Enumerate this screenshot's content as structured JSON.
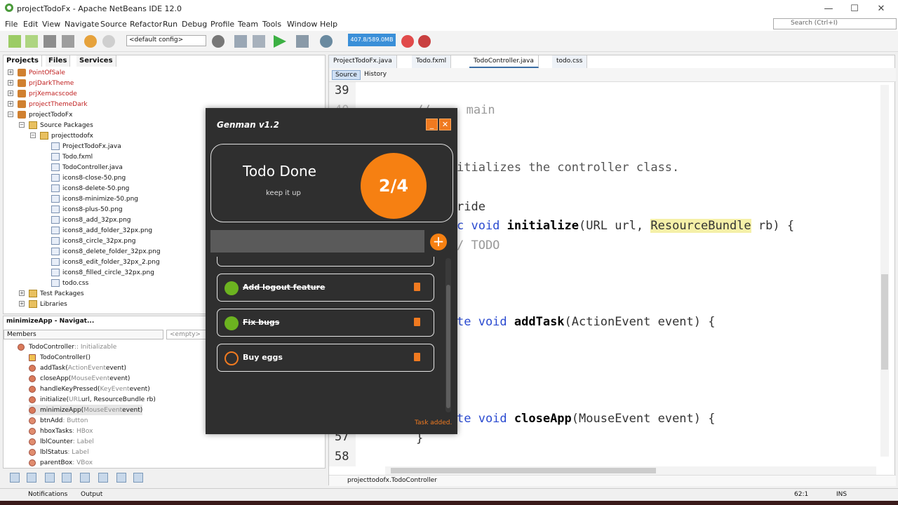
{
  "window": {
    "title": "projectTodoFx - Apache NetBeans IDE 12.0"
  },
  "menu": [
    "File",
    "Edit",
    "View",
    "Navigate",
    "Source",
    "Refactor",
    "Run",
    "Debug",
    "Profile",
    "Team",
    "Tools",
    "Window",
    "Help"
  ],
  "search": {
    "placeholder": "Search (Ctrl+I)"
  },
  "toolbar": {
    "config": "<default config>",
    "memory": "407.8/589.0MB"
  },
  "projects_panel": {
    "tabs": [
      "Projects",
      "Files",
      "Services"
    ],
    "tree": [
      {
        "label": "PointOfSale",
        "red": true
      },
      {
        "label": "prjDarkTheme",
        "red": true
      },
      {
        "label": "prjXemacscode",
        "red": true
      },
      {
        "label": "projectThemeDark",
        "red": true
      },
      {
        "label": "projectTodoFx",
        "red": false
      },
      {
        "label": "Source Packages",
        "red": false
      },
      {
        "label": "projecttodofx",
        "red": false
      },
      {
        "label": "ProjectTodoFx.java",
        "red": false
      },
      {
        "label": "Todo.fxml",
        "red": false
      },
      {
        "label": "TodoController.java",
        "red": false
      },
      {
        "label": "icons8-close-50.png",
        "red": false
      },
      {
        "label": "icons8-delete-50.png",
        "red": false
      },
      {
        "label": "icons8-minimize-50.png",
        "red": false
      },
      {
        "label": "icons8-plus-50.png",
        "red": false
      },
      {
        "label": "icons8_add_32px.png",
        "red": false
      },
      {
        "label": "icons8_add_folder_32px.png",
        "red": false
      },
      {
        "label": "icons8_circle_32px.png",
        "red": false
      },
      {
        "label": "icons8_delete_folder_32px.png",
        "red": false
      },
      {
        "label": "icons8_edit_folder_32px_2.png",
        "red": false
      },
      {
        "label": "icons8_filled_circle_32px.png",
        "red": false
      },
      {
        "label": "todo.css",
        "red": false
      },
      {
        "label": "Test Packages",
        "red": false
      },
      {
        "label": "Libraries",
        "red": false
      }
    ]
  },
  "navigator": {
    "title": "minimizeApp - Navigat...",
    "members_select": "Members",
    "empty_select": "<empty>",
    "items": [
      {
        "name": "TodoController",
        "type": " :: Initializable"
      },
      {
        "name": "TodoController()",
        "type": ""
      },
      {
        "name": "addTask(",
        "type": "ActionEvent",
        "tail": " event)"
      },
      {
        "name": "closeApp(",
        "type": "MouseEvent",
        "tail": " event)"
      },
      {
        "name": "handleKeyPressed(",
        "type": "KeyEvent",
        "tail": " event)"
      },
      {
        "name": "initialize(",
        "type": "URL",
        "tail": " url, ResourceBundle rb)"
      },
      {
        "name": "minimizeApp(",
        "type": "MouseEvent",
        "tail": " event)"
      },
      {
        "name": "btnAdd",
        "type": " : Button"
      },
      {
        "name": "hboxTasks",
        "type": " : HBox"
      },
      {
        "name": "lblCounter",
        "type": " : Label"
      },
      {
        "name": "lblStatus",
        "type": " : Label"
      },
      {
        "name": "parentBox",
        "type": " : VBox"
      }
    ]
  },
  "editor": {
    "tabs": [
      "ProjectTodoFx.java",
      "Todo.fxml",
      "TodoController.java",
      "todo.css"
    ],
    "source_label": "Source",
    "history_label": "History",
    "line_numbers": [
      "39",
      "40",
      "57",
      "58"
    ],
    "code": {
      "l1": "// ... main",
      "l2a": "itializes the controller class.",
      "l3": "ride",
      "l4_kw": "c void ",
      "l4_fn": "initialize",
      "l4_a": "(URL url, ",
      "l4_hl": "ResourceBundle",
      "l4_b": " rb) {",
      "l5": "/ TODO",
      "l6_kw": "te void ",
      "l6_fn": "addTask",
      "l6_a": "(ActionEvent event) {",
      "l7_kw": "te void ",
      "l7_fn": "closeApp",
      "l7_a": "(MouseEvent event) {",
      "l8": "}"
    },
    "breadcrumb": "projecttodofx.TodoController"
  },
  "statusbar": {
    "notifications": "Notifications",
    "output": "Output",
    "position": "62:1",
    "mode": "INS"
  },
  "todo_app": {
    "title": "Genman v1.2",
    "minimize": "_",
    "close": "✕",
    "card_title": "Todo Done",
    "card_sub": "keep it up",
    "counter": "2/4",
    "input_value": "",
    "add": "+",
    "tasks": [
      {
        "label": "Add logout feature",
        "done": true
      },
      {
        "label": "Fix bugs",
        "done": true
      },
      {
        "label": "Buy eggs",
        "done": false
      }
    ],
    "status": "Task added."
  }
}
